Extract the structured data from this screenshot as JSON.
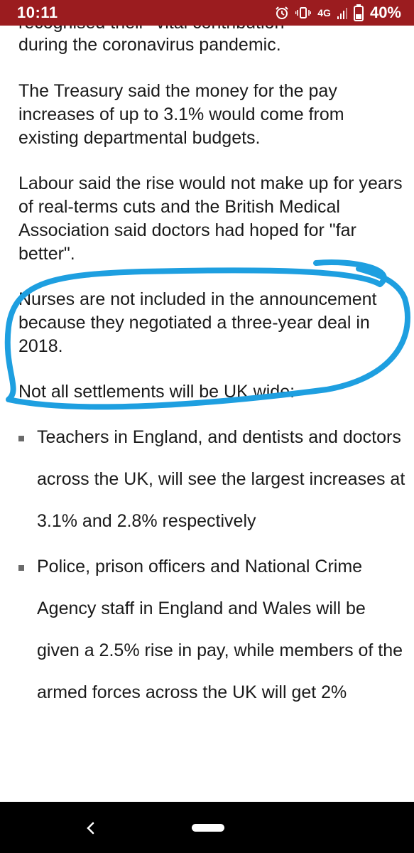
{
  "status_bar": {
    "time": "10:11",
    "network": "4G",
    "battery": "40%",
    "icons": [
      "alarm-icon",
      "vibrate-icon",
      "signal-icon",
      "battery-icon"
    ],
    "background": "#9b1c1f"
  },
  "article": {
    "cut_line": "recognised their \"vital contribution",
    "paragraphs": [
      "during the coronavirus pandemic.",
      "The Treasury said the money for the pay increases of up to 3.1% would come from existing departmental budgets.",
      "Labour said the rise would not make up for years of real-terms cuts and the British Medical Association said doctors had hoped for \"far better\".",
      "Nurses are not included in the announcement because they negotiated a three-year deal in 2018.",
      "Not all settlements will be UK wide:"
    ],
    "bullets": [
      "Teachers in England, and dentists and doctors across the UK, will see the largest increases at 3.1% and 2.8% respectively",
      "Police, prison officers and National Crime Agency staff in England and Wales will be given a 2.5% rise in pay, while members of the armed forces across the UK will get 2%"
    ]
  },
  "annotation": {
    "color": "#1e9fe0",
    "type": "hand-drawn circle"
  },
  "nav_bar": {
    "icons": [
      "back-icon",
      "home-pill-icon"
    ]
  }
}
